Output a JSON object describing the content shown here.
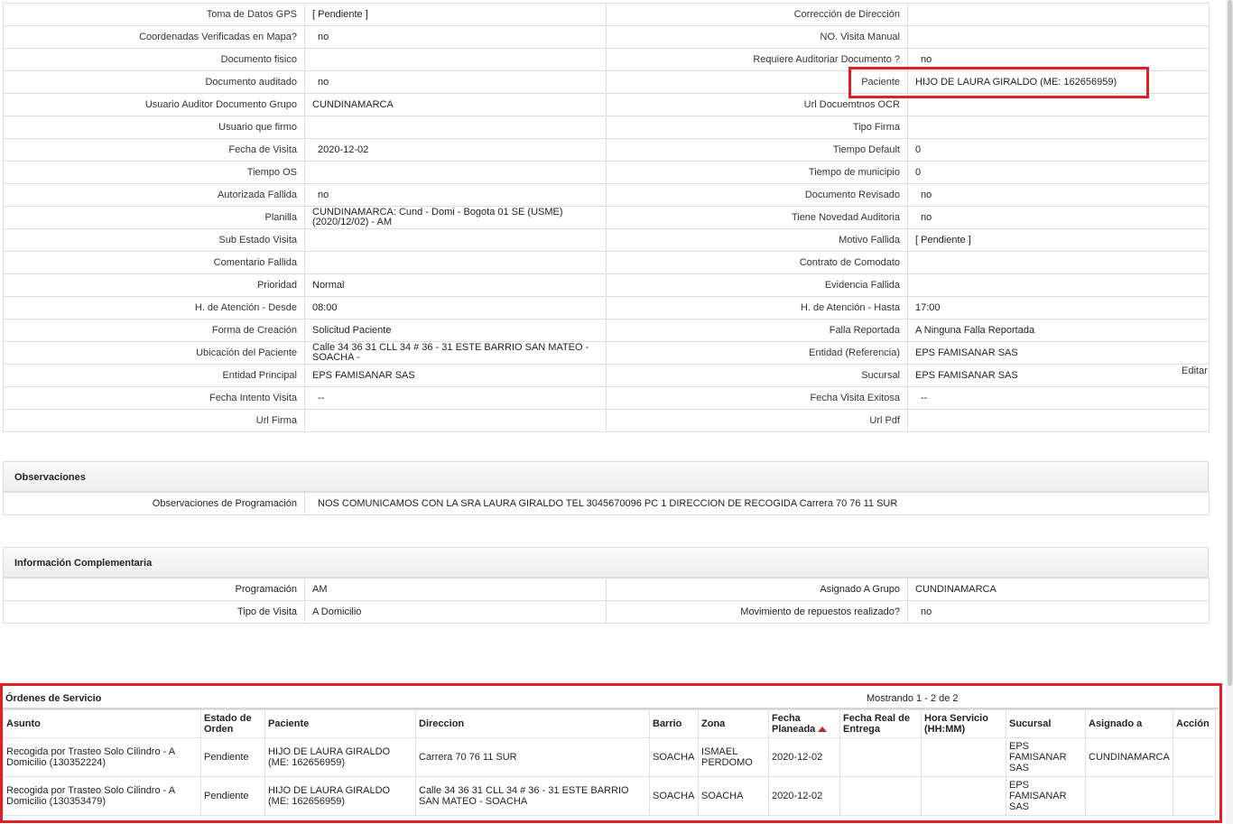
{
  "fields": [
    {
      "l1": "Toma de Datos GPS",
      "v1": "[ Pendiente ]",
      "l2": "Corrección de Dirección",
      "v2": ""
    },
    {
      "l1": "Coordenadas Verificadas en Mapa?",
      "v1": "no",
      "l2": "NO. Visita Manual",
      "v2": ""
    },
    {
      "l1": "Documento fisico",
      "v1": "",
      "l2": "Requiere Auditoriar Documento ?",
      "v2": "no"
    },
    {
      "l1": "Documento auditado",
      "v1": "no",
      "l2": "Paciente",
      "v2": "HIJO DE LAURA GIRALDO (ME: 162656959)"
    },
    {
      "l1": "Usuario Auditor Documento Grupo",
      "v1": "CUNDINAMARCA",
      "l2": "Url Docuemtnos OCR",
      "v2": ""
    },
    {
      "l1": "Usuario que firmo",
      "v1": "",
      "l2": "Tipo Firma",
      "v2": ""
    },
    {
      "l1": "Fecha de Visita",
      "v1": "2020-12-02",
      "l2": "Tiempo Default",
      "v2": "0"
    },
    {
      "l1": "Tiempo OS",
      "v1": "",
      "l2": "Tiempo de municipio",
      "v2": "0"
    },
    {
      "l1": "Autorizada Fallida",
      "v1": "no",
      "l2": "Documento Revisado",
      "v2": "no"
    },
    {
      "l1": "Planilla",
      "v1": "CUNDINAMARCA: Cund - Domi - Bogota 01 SE (USME) (2020/12/02) - AM",
      "l2": "Tiene Novedad Auditoria",
      "v2": "no"
    },
    {
      "l1": "Sub Estado Visita",
      "v1": "",
      "l2": "Motivo Fallida",
      "v2": "[ Pendiente ]"
    },
    {
      "l1": "Comentario Fallida",
      "v1": "",
      "l2": "Contrato de Comodato",
      "v2": ""
    },
    {
      "l1": "Prioridad",
      "v1": "Normal",
      "l2": "Evidencia Fallida",
      "v2": ""
    },
    {
      "l1": "H. de Atención - Desde",
      "v1": "08:00",
      "l2": "H. de Atención - Hasta",
      "v2": "17:00"
    },
    {
      "l1": "Forma de Creación",
      "v1": "Solicitud Paciente",
      "l2": "Falla Reportada",
      "v2": "A Ninguna Falla Reportada"
    },
    {
      "l1": "Ubicación del Paciente",
      "v1": "Calle 34 36 31 CLL 34 # 36 - 31 ESTE BARRIO SAN MATEO - SOACHA -",
      "l2": "Entidad (Referencia)",
      "v2": "EPS FAMISANAR SAS"
    },
    {
      "l1": "Entidad Principal",
      "v1": "EPS FAMISANAR SAS",
      "l2": "Sucursal",
      "v2": "EPS FAMISANAR SAS"
    },
    {
      "l1": "Fecha Intento Visita",
      "v1": "--",
      "l2": "Fecha Visita Exitosa",
      "v2": "--"
    },
    {
      "l1": "Url Firma",
      "v1": "",
      "l2": "Url Pdf",
      "v2": ""
    }
  ],
  "editar_label": "Editar",
  "observaciones": {
    "title": "Observaciones",
    "label": "Observaciones de Programación",
    "value": "NOS COMUNICAMOS CON LA SRA LAURA GIRALDO TEL 3045670096 PC 1 DIRECCION DE RECOGIDA Carrera 70 76 11 SUR"
  },
  "complementaria": {
    "title": "Información Complementaria",
    "rows": [
      {
        "l1": "Programación",
        "v1": "AM",
        "l2": "Asignado A Grupo",
        "v2": "CUNDINAMARCA"
      },
      {
        "l1": "Tipo de Visita",
        "v1": "A Domicilio",
        "l2": "Movimiento de repuestos realizado?",
        "v2": "no"
      }
    ]
  },
  "orders": {
    "title": "Órdenes de Servicio",
    "showing": "Mostrando 1 - 2 de 2",
    "columns": [
      "Asunto",
      "Estado de Orden",
      "Paciente",
      "Direccion",
      "Barrio",
      "Zona",
      "Fecha Planeada",
      "Fecha Real de Entrega",
      "Hora Servicio (HH:MM)",
      "Sucursal",
      "Asignado a",
      "Acción"
    ],
    "rows": [
      [
        "Recogida por Trasteo Solo Cilindro - A Domicilio (130352224)",
        "Pendiente",
        "HIJO DE LAURA GIRALDO (ME: 162656959)",
        "Carrera 70 76 11 SUR",
        "SOACHA",
        "ISMAEL PERDOMO",
        "2020-12-02",
        "",
        "",
        "EPS FAMISANAR SAS",
        "CUNDINAMARCA",
        ""
      ],
      [
        "Recogida por Trasteo Solo Cilindro - A Domicilio (130353479)",
        "Pendiente",
        "HIJO DE LAURA GIRALDO (ME: 162656959)",
        "Calle 34 36 31 CLL 34 # 36 - 31 ESTE BARRIO SAN MATEO - SOACHA",
        "SOACHA",
        "SOACHA",
        "2020-12-02",
        "",
        "",
        "EPS FAMISANAR SAS",
        "",
        ""
      ]
    ]
  },
  "colors": {
    "highlight": "#e01f26",
    "sort_arrow": "#c0262c"
  }
}
